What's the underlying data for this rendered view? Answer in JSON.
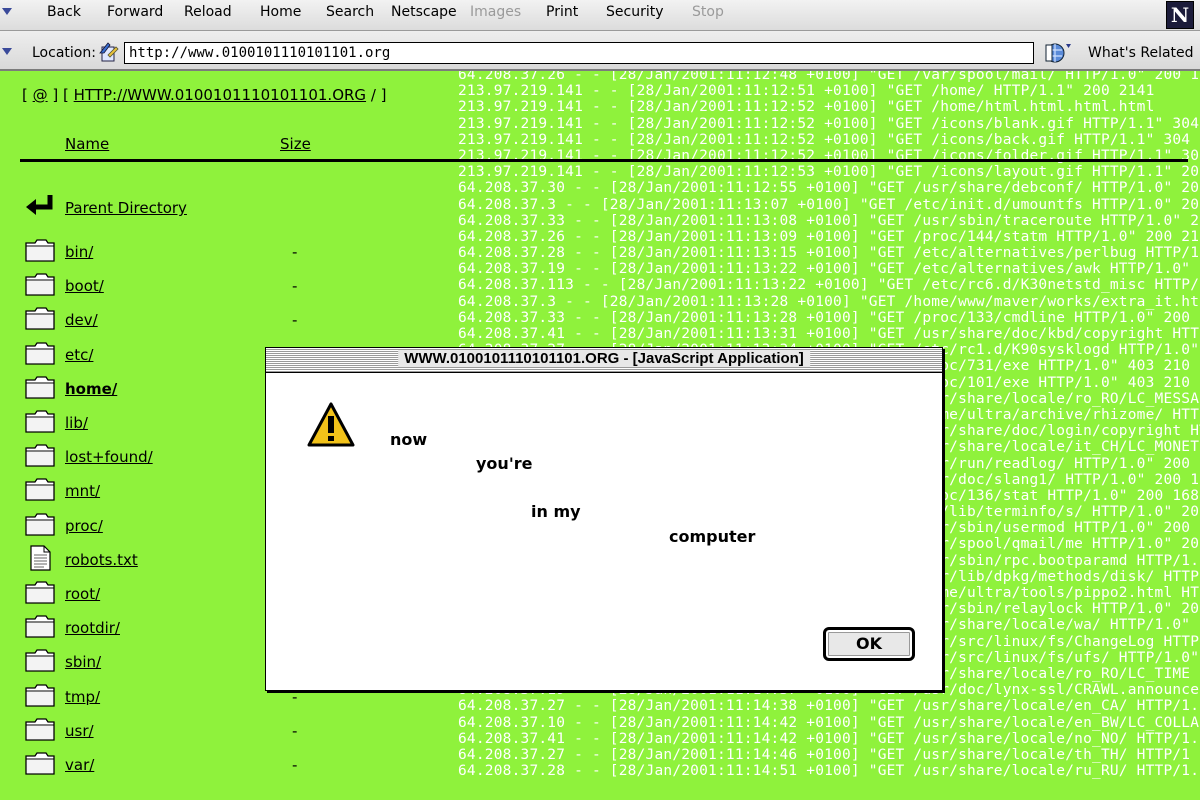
{
  "toolbar": {
    "buttons": [
      {
        "label": "Back",
        "enabled": true
      },
      {
        "label": "Forward",
        "enabled": true
      },
      {
        "label": "Reload",
        "enabled": true
      },
      {
        "label": "Home",
        "enabled": true
      },
      {
        "label": "Search",
        "enabled": true
      },
      {
        "label": "Netscape",
        "enabled": true
      },
      {
        "label": "Images",
        "enabled": false
      },
      {
        "label": "Print",
        "enabled": true
      },
      {
        "label": "Security",
        "enabled": true
      },
      {
        "label": "Stop",
        "enabled": false
      }
    ],
    "logo": "N"
  },
  "location": {
    "label": "Location:",
    "url": "http://www.0100101110101101.org",
    "related_label": "What's Related"
  },
  "page": {
    "breadcrumb": {
      "open": "[ ",
      "home_link": "@",
      "mid": " ] [ ",
      "site_link": "HTTP://WWW.0100101110101101.ORG",
      "close": " / ]"
    },
    "columns": {
      "name": "Name",
      "size": "Size"
    },
    "parent": "Parent Directory",
    "entries": [
      {
        "name": "bin/",
        "type": "folder",
        "size": "-",
        "bold": false
      },
      {
        "name": "boot/",
        "type": "folder",
        "size": "-",
        "bold": false
      },
      {
        "name": "dev/",
        "type": "folder",
        "size": "-",
        "bold": false
      },
      {
        "name": "etc/",
        "type": "folder",
        "size": "",
        "bold": false
      },
      {
        "name": "home/",
        "type": "folder",
        "size": "",
        "bold": true
      },
      {
        "name": "lib/",
        "type": "folder",
        "size": "",
        "bold": false
      },
      {
        "name": "lost+found/",
        "type": "folder",
        "size": "",
        "bold": false
      },
      {
        "name": "mnt/",
        "type": "folder",
        "size": "",
        "bold": false
      },
      {
        "name": "proc/",
        "type": "folder",
        "size": "",
        "bold": false
      },
      {
        "name": "robots.txt",
        "type": "file",
        "size": "",
        "bold": false
      },
      {
        "name": "root/",
        "type": "folder",
        "size": "",
        "bold": false
      },
      {
        "name": "rootdir/",
        "type": "folder",
        "size": "",
        "bold": false
      },
      {
        "name": "sbin/",
        "type": "folder",
        "size": "",
        "bold": false
      },
      {
        "name": "tmp/",
        "type": "folder",
        "size": "-",
        "bold": false
      },
      {
        "name": "usr/",
        "type": "folder",
        "size": "-",
        "bold": false
      },
      {
        "name": "var/",
        "type": "folder",
        "size": "-",
        "bold": false
      }
    ],
    "logs": [
      "64.208.37.26 - - [28/Jan/2001:11:12:48 +0100] \"GET /var/spool/mail/ HTTP/1.0\" 200 1",
      "213.97.219.141 - - [28/Jan/2001:11:12:51 +0100] \"GET /home/ HTTP/1.1\" 200 2141",
      "213.97.219.141 - - [28/Jan/2001:11:12:52 +0100] \"GET /home/html.html.html.html",
      "213.97.219.141 - - [28/Jan/2001:11:12:52 +0100] \"GET /icons/blank.gif HTTP/1.1\" 304",
      "213.97.219.141 - - [28/Jan/2001:11:12:52 +0100] \"GET /icons/back.gif HTTP/1.1\" 304",
      "213.97.219.141 - - [28/Jan/2001:11:12:52 +0100] \"GET /icons/folder.gif HTTP/1.1\" 30",
      "213.97.219.141 - - [28/Jan/2001:11:12:53 +0100] \"GET /icons/layout.gif HTTP/1.1\" 20",
      "64.208.37.30 - - [28/Jan/2001:11:12:55 +0100] \"GET /usr/share/debconf/ HTTP/1.0\" 20",
      "64.208.37.3 - - [28/Jan/2001:11:13:07 +0100] \"GET /etc/init.d/umountfs HTTP/1.0\" 20",
      "64.208.37.33 - - [28/Jan/2001:11:13:08 +0100] \"GET /usr/sbin/traceroute HTTP/1.0\" 2",
      "64.208.37.26 - - [28/Jan/2001:11:13:09 +0100] \"GET /proc/144/statm HTTP/1.0\" 200 21",
      "64.208.37.28 - - [28/Jan/2001:11:13:15 +0100] \"GET /etc/alternatives/perlbug HTTP/1",
      "64.208.37.19 - - [28/Jan/2001:11:13:22 +0100] \"GET /etc/alternatives/awk HTTP/1.0\" 2",
      "64.208.37.113 - - [28/Jan/2001:11:13:22 +0100] \"GET /etc/rc6.d/K30netstd_misc HTTP/",
      "64.208.37.3 - - [28/Jan/2001:11:13:28 +0100] \"GET /home/www/maver/works/extra_it.ht",
      "64.208.37.33 - - [28/Jan/2001:11:13:28 +0100] \"GET /proc/133/cmdline HTTP/1.0\" 200 1",
      "64.208.37.41 - - [28/Jan/2001:11:13:31 +0100] \"GET /usr/share/doc/kbd/copyright HTTP/1.0\"",
      "64.208.37.27 - - [28/Jan/2001:11:13:34 +0100] \"GET /etc/rc1.d/K90sysklogd HTTP/1.0\"",
      "64.208.37.10 - - [28/Jan/2001:11:13:36 +0100] \"GET /proc/731/exe HTTP/1.0\" 403 210",
      "64.208.37.19 - - [28/Jan/2001:11:13:39 +0100] \"GET /proc/101/exe HTTP/1.0\" 403 210",
      "64.208.37.26 - - [28/Jan/2001:11:13:41 +0100] \"GET /usr/share/locale/ro_RO/LC_MESSA",
      "64.208.37.30 - - [28/Jan/2001:11:13:43 +0100] \"GET /home/ultra/archive/rhizome/ HTTP/",
      "64.208.37.28 - - [28/Jan/2001:11:13:47 +0100] \"GET /usr/share/doc/login/copyright HTTP/1.0\"",
      "64.208.37.33 - - [28/Jan/2001:11:13:49 +0100] \"GET /usr/share/locale/it_CH/LC_MONET",
      "64.208.37.27 - - [28/Jan/2001:11:13:52 +0100] \"GET /var/run/readlog/ HTTP/1.0\" 200 1",
      "64.208.37.41 - - [28/Jan/2001:11:13:55 +0100] \"GET /usr/doc/slang1/ HTTP/1.0\" 200 1",
      "64.208.37.10 - - [28/Jan/2001:11:13:58 +0100] \"GET /proc/136/stat HTTP/1.0\" 200 168",
      "64.208.37.3 - - [28/Jan/2001:11:14:01 +0100] \"GET /usr/lib/terminfo/s/ HTTP/1.0\" 200 1",
      "64.208.37.19 - - [28/Jan/2001:11:14:04 +0100] \"GET /usr/sbin/usermod HTTP/1.0\" 200",
      "64.208.37.26 - - [28/Jan/2001:11:14:07 +0100] \"GET /var/spool/qmail/me HTTP/1.0\" 200 25",
      "64.208.37.33 - - [28/Jan/2001:11:14:10 +0100] \"GET /usr/sbin/rpc.bootparamd HTTP/1.",
      "64.208.37.28 - - [28/Jan/2001:11:14:13 +0100] \"GET /var/lib/dpkg/methods/disk/ HTTP",
      "64.208.37.30 - - [28/Jan/2001:11:14:16 +0100] \"GET /home/ultra/tools/pippo2.html HT",
      "64.208.37.27 - - [28/Jan/2001:11:14:19 +0100] \"GET /usr/sbin/relaylock HTTP/1.0\" 20",
      "64.208.37.41 - - [28/Jan/2001:11:14:22 +0100] \"GET /usr/share/locale/wa/ HTTP/1.0\"",
      "64.208.37.10 - - [28/Jan/2001:11:14:25 +0100] \"GET /usr/src/linux/fs/ChangeLog HTTP",
      "64.208.37.19 - - [28/Jan/2001:11:14:31 +0100] \"GET /usr/src/linux/fs/ufs/ HTTP/1.0\"",
      "64.208.37.30 - - [28/Jan/2001:11:14:36 +0100] \"GET /usr/share/locale/ro_RO/LC_TIME",
      "64.208.37.19 - - [28/Jan/2001:11:14:37 +0100] \"GET /usr/doc/lynx-ssl/CRAWL.announce",
      "64.208.37.27 - - [28/Jan/2001:11:14:38 +0100] \"GET /usr/share/locale/en_CA/ HTTP/1.0",
      "64.208.37.10 - - [28/Jan/2001:11:14:42 +0100] \"GET /usr/share/locale/en_BW/LC_COLLA",
      "64.208.37.41 - - [28/Jan/2001:11:14:42 +0100] \"GET /usr/share/locale/no_NO/ HTTP/1.0",
      "64.208.37.27 - - [28/Jan/2001:11:14:46 +0100] \"GET /usr/share/locale/th_TH/ HTTP/1",
      "64.208.37.28 - - [28/Jan/2001:11:14:51 +0100] \"GET /usr/share/locale/ru_RU/ HTTP/1.0\""
    ]
  },
  "dialog": {
    "title": "WWW.0100101110101101.ORG - [JavaScript Application]",
    "words": [
      "now",
      "you're",
      "in my",
      "computer"
    ],
    "ok_label": "OK",
    "icon": "warning-icon"
  }
}
